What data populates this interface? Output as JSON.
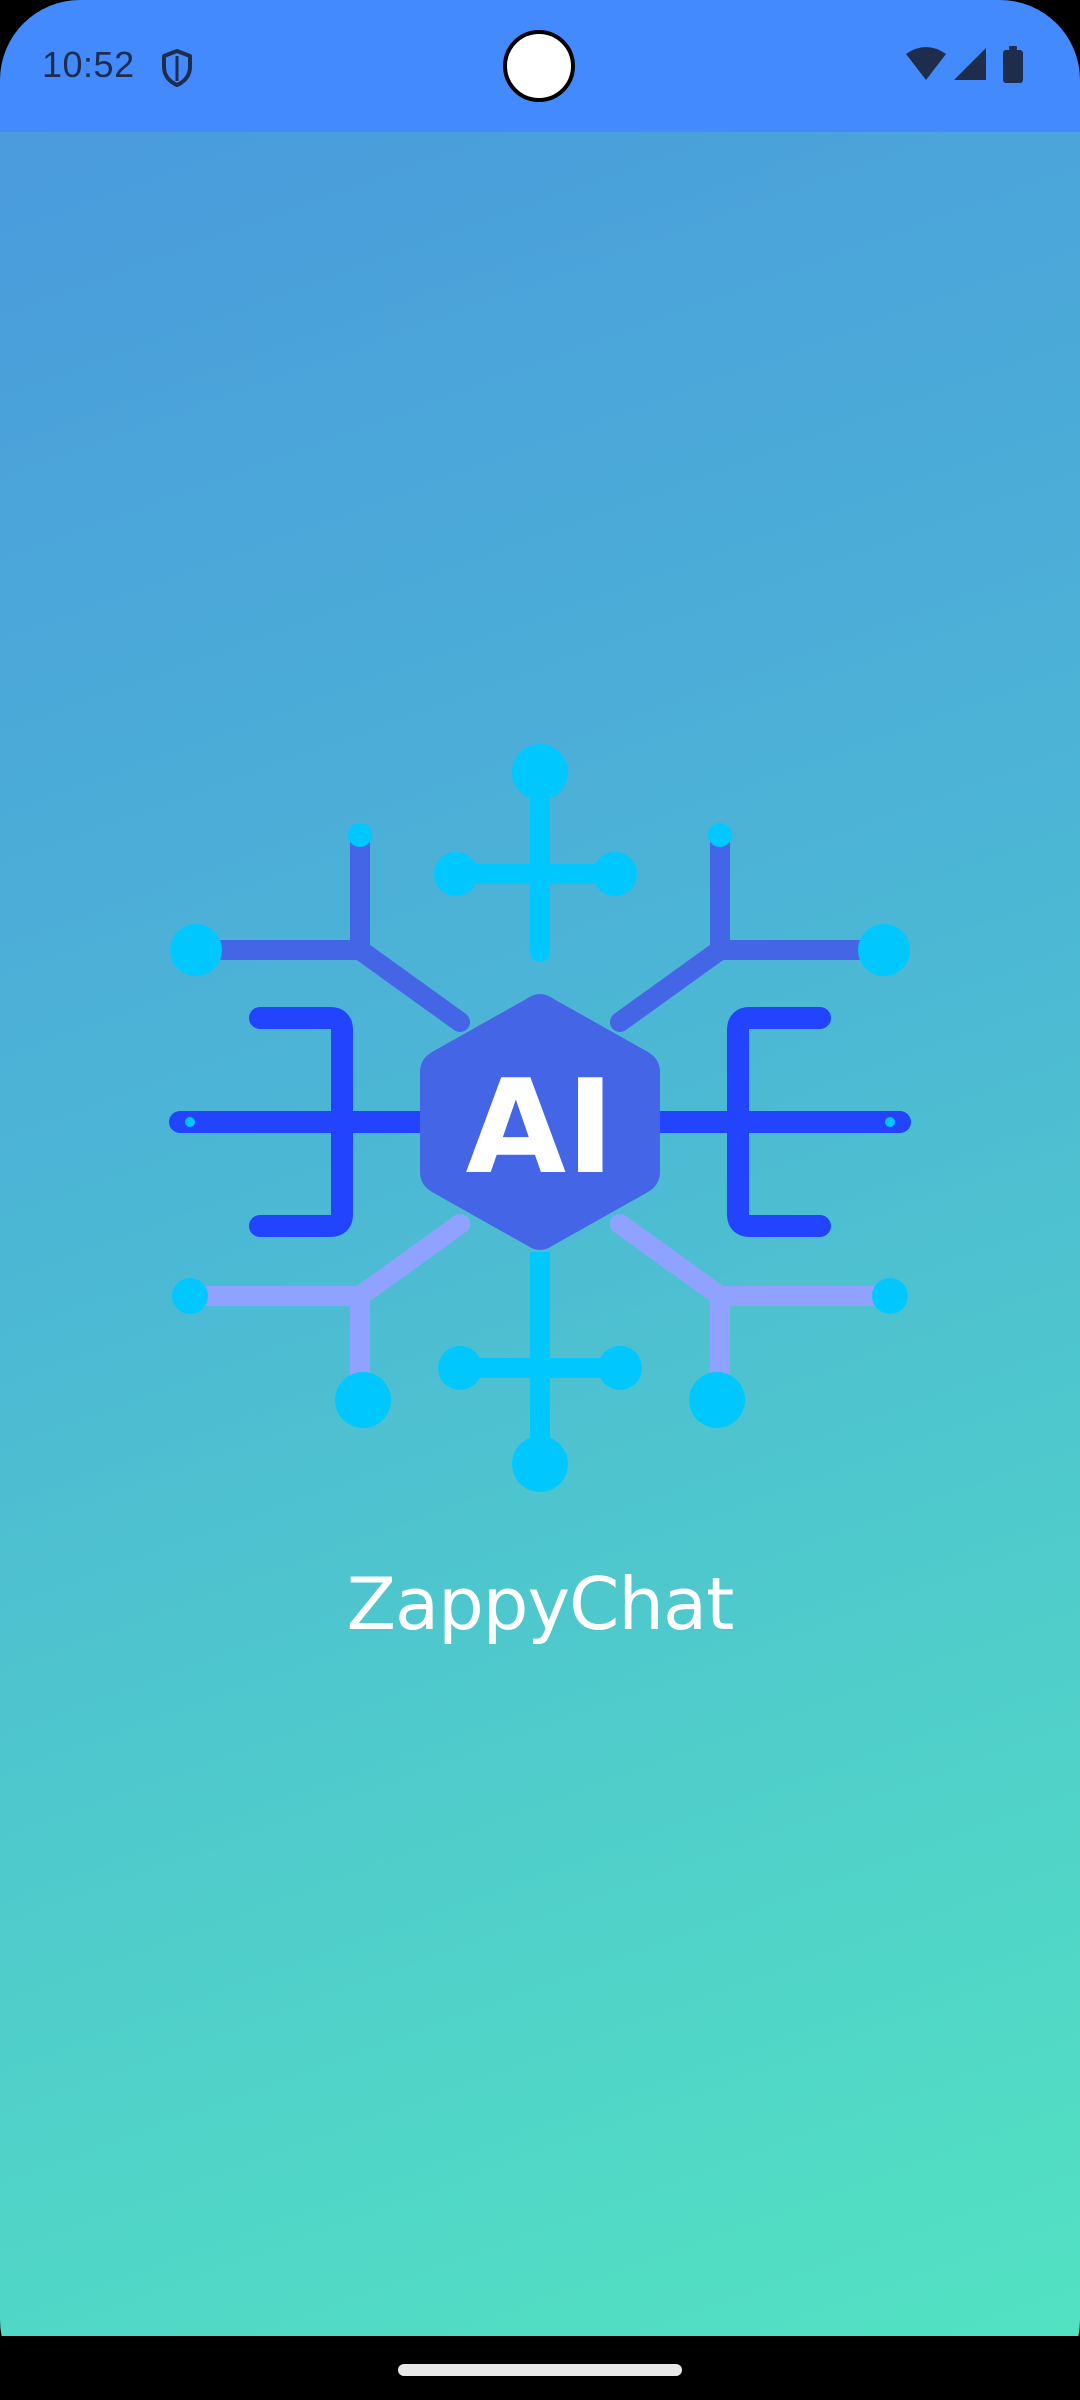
{
  "status_bar": {
    "time": "10:52",
    "icons": [
      "shield-icon",
      "wifi-icon",
      "cellular-signal-icon",
      "battery-icon"
    ],
    "background_color": "#448AFF"
  },
  "logo": {
    "text": "AI",
    "icon": "ai-network-hexagon-icon",
    "colors": {
      "hexagon": "#4466E6",
      "nodes": "#00C8FF",
      "dark_lines": "#2244FF",
      "light_lines": "#8FA2FF"
    }
  },
  "app": {
    "name": "ZappyChat"
  },
  "background": {
    "gradient_start": "#4A9BDC",
    "gradient_end": "#52E2C2"
  }
}
